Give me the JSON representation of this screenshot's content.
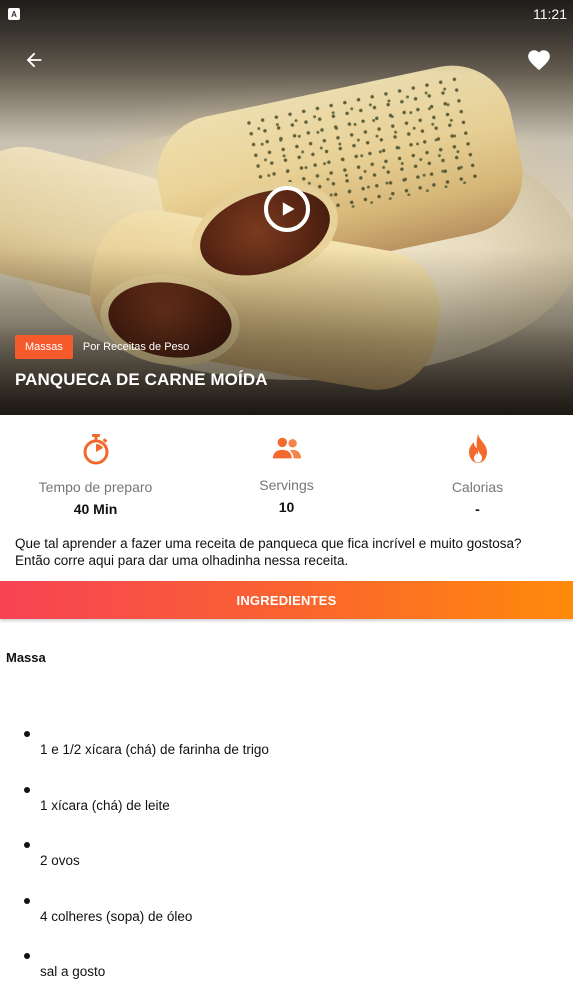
{
  "status_bar": {
    "time": "11:21",
    "app_icon_letter": "A"
  },
  "hero": {
    "back_icon": "arrow-left-icon",
    "favorite_icon": "heart-icon",
    "play_icon": "play-circle-icon",
    "category": "Massas",
    "author": "Por Receitas de Peso",
    "title": "PANQUECA DE CARNE MOÍDA"
  },
  "stats": [
    {
      "icon": "stopwatch-icon",
      "label": "Tempo de preparo",
      "value": "40 Min"
    },
    {
      "icon": "people-icon",
      "label": "Servings",
      "value": "10"
    },
    {
      "icon": "flame-icon",
      "label": "Calorias",
      "value": "-"
    }
  ],
  "description": "Que tal aprender a fazer uma receita de panqueca que fica incrível e muito gostosa? Então corre aqui para dar uma olhadinha nessa receita.",
  "tab": {
    "label": "INGREDIENTES"
  },
  "section": {
    "heading": "Massa"
  },
  "ingredients": [
    "1 e 1/2 xícara (chá) de farinha de trigo",
    "1 xícara (chá) de leite",
    "2 ovos",
    "4 colheres (sopa) de óleo",
    "sal a gosto"
  ],
  "colors": {
    "accent": "#f55a2c",
    "gradient_start": "#f74355",
    "gradient_end": "#ff8a0a"
  }
}
